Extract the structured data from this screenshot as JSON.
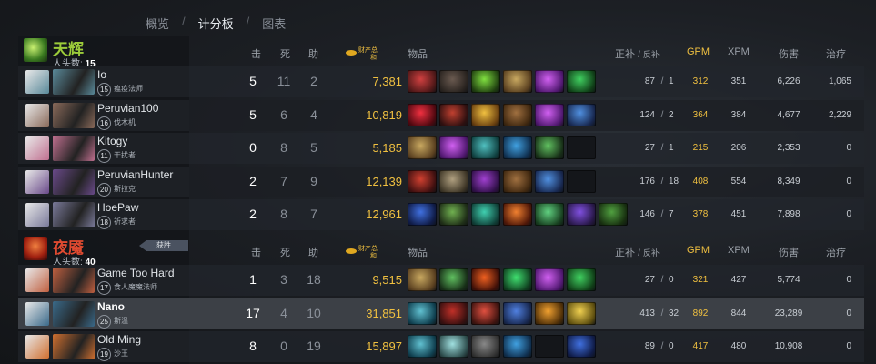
{
  "nav": {
    "overview": "概览",
    "sep1": "/",
    "scoreboard": "计分板",
    "sep2": "/",
    "charts": "图表"
  },
  "headers": {
    "k": "击",
    "d": "死",
    "a": "助",
    "networth_top": "财产总",
    "networth_bottom": "和",
    "items": "物品",
    "lasthits": "正补",
    "slash": "/",
    "denies": "反补",
    "gpm": "GPM",
    "xpm": "XPM",
    "damage": "伤害",
    "heal": "治疗"
  },
  "radiant": {
    "name": "天辉",
    "kills_label": "人头数:",
    "kills": "15"
  },
  "dire": {
    "name": "夜魇",
    "kills_label": "人头数:",
    "kills": "40",
    "tag": "获胜"
  },
  "colors": {
    "radiant": "#9ccc3a",
    "dire": "#d8432f",
    "gold": "#f0c040",
    "highlight": "#3c4046"
  },
  "radiant_players": [
    {
      "name": "Io",
      "level": "15",
      "hero": "瘟疫法师",
      "k": "5",
      "d": "11",
      "a": "2",
      "nw": "7,381",
      "lh": "87",
      "dn": "1",
      "gpm": "312",
      "xpm": "351",
      "dmg": "6,226",
      "heal": "1,065",
      "items": [
        "item-red-eye-icon",
        "item-claw-icon",
        "item-green-orb-icon",
        "item-scroll-icon",
        "item-purple-orb-icon",
        "item-green-boots-icon"
      ]
    },
    {
      "name": "Peruvian100",
      "level": "16",
      "hero": "伐木机",
      "k": "5",
      "d": "6",
      "a": "4",
      "nw": "10,819",
      "lh": "124",
      "dn": "2",
      "gpm": "364",
      "xpm": "384",
      "dmg": "4,677",
      "heal": "2,229",
      "items": [
        "item-red-gem-icon",
        "item-crimson-guard-icon",
        "item-gold-leaf-icon",
        "item-brown-boots-icon",
        "item-purple-orb-icon",
        "item-blue-staff-icon"
      ]
    },
    {
      "name": "Kitogy",
      "level": "11",
      "hero": "干扰者",
      "k": "0",
      "d": "8",
      "a": "5",
      "nw": "5,185",
      "lh": "27",
      "dn": "1",
      "gpm": "215",
      "xpm": "206",
      "dmg": "2,353",
      "heal": "0",
      "items": [
        "item-scroll-icon",
        "item-purple-orb-icon",
        "item-teal-helm-icon",
        "item-blue-wand-icon",
        "item-green-dagger-icon",
        "empty"
      ]
    },
    {
      "name": "PeruvianHunter",
      "level": "20",
      "hero": "斯拉克",
      "k": "2",
      "d": "7",
      "a": "9",
      "nw": "12,139",
      "lh": "176",
      "dn": "18",
      "gpm": "408",
      "xpm": "554",
      "dmg": "8,349",
      "heal": "0",
      "items": [
        "item-red-claw-icon",
        "item-axe-icon",
        "item-purple-blade-icon",
        "item-brown-boots-icon",
        "item-blue-staff-icon",
        "empty"
      ]
    },
    {
      "name": "HoePaw",
      "level": "18",
      "hero": "祈求者",
      "k": "2",
      "d": "8",
      "a": "7",
      "nw": "12,961",
      "lh": "146",
      "dn": "7",
      "gpm": "378",
      "xpm": "451",
      "dmg": "7,898",
      "heal": "0",
      "items": [
        "item-blue-spear-icon",
        "item-green-hood-icon",
        "item-teal-orb-icon",
        "item-fire-icon",
        "item-green-ring-icon",
        "item-purple-boots-icon",
        "item-green-branch-icon"
      ]
    }
  ],
  "dire_players": [
    {
      "name": "Game Too Hard",
      "level": "17",
      "hero": "食人魔魔法师",
      "k": "1",
      "d": "3",
      "a": "18",
      "nw": "9,515",
      "lh": "27",
      "dn": "0",
      "gpm": "321",
      "xpm": "427",
      "dmg": "5,774",
      "heal": "0",
      "items": [
        "item-scroll-icon",
        "item-green-dagger-icon",
        "item-fire-staff-icon",
        "item-green-gem-icon",
        "item-purple-orb-icon",
        "item-green-boots-icon"
      ]
    },
    {
      "name": "Nano",
      "level": "25",
      "hero": "斯温",
      "k": "17",
      "d": "4",
      "a": "10",
      "nw": "31,851",
      "lh": "413",
      "dn": "32",
      "gpm": "892",
      "xpm": "844",
      "dmg": "23,289",
      "heal": "0",
      "items": [
        "item-teal-axe-icon",
        "item-red-cloak-icon",
        "item-red-mask-icon",
        "item-blue-hammer-icon",
        "item-orange-shield-icon",
        "item-gold-crown-icon"
      ]
    },
    {
      "name": "Old Ming",
      "level": "19",
      "hero": "沙王",
      "k": "8",
      "d": "0",
      "a": "19",
      "nw": "15,897",
      "lh": "89",
      "dn": "0",
      "gpm": "417",
      "xpm": "480",
      "dmg": "10,908",
      "heal": "0",
      "items": [
        "item-teal-axe-icon",
        "item-swirl-icon",
        "item-teal-staff-icon",
        "item-blue-wand-icon",
        "empty",
        "item-blue-spear-icon"
      ]
    }
  ]
}
